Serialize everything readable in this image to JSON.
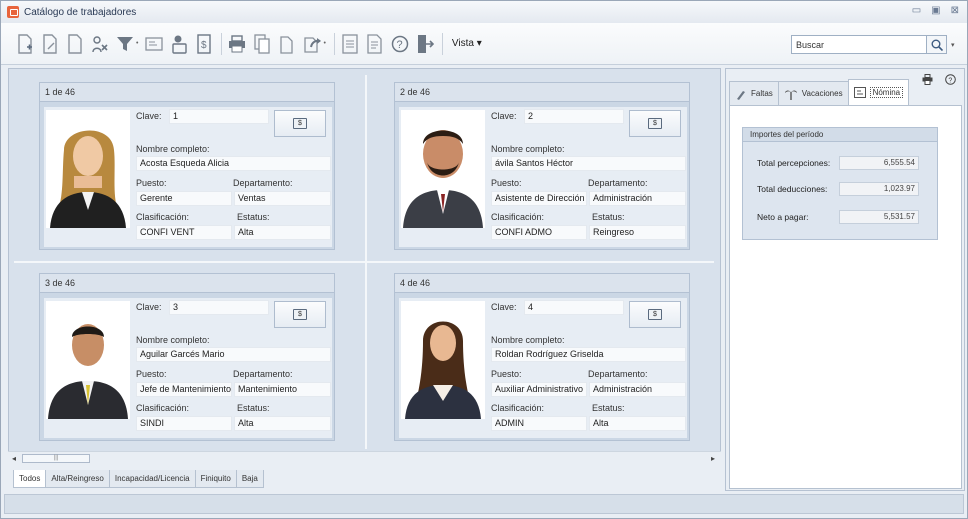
{
  "window": {
    "title": "Catálogo de trabajadores",
    "controls": [
      "▭",
      "▣",
      "⊠"
    ]
  },
  "toolbar": {
    "buttons": [
      "new-icon",
      "edit-icon",
      "blank-icon",
      "delete-icon",
      "filter-icon",
      "report-icon",
      "user-search-icon",
      "payroll-icon",
      "print-icon",
      "copy-icon",
      "document-icon",
      "refresh-icon",
      "export-icon",
      "list-icon",
      "help-icon",
      "exit-icon"
    ],
    "vista_label": "Vista ▾",
    "search_placeholder": "Buscar"
  },
  "cards": [
    {
      "header": "1 de 46",
      "clave_label": "Clave:",
      "clave": "1",
      "nombre_label": "Nombre completo:",
      "nombre": "Acosta Esqueda Alicia",
      "puesto_label": "Puesto:",
      "puesto": "Gerente",
      "depto_label": "Departamento:",
      "depto": "Ventas",
      "clasif_label": "Clasificación:",
      "clasif": "CONFI VENT",
      "estatus_label": "Estatus:",
      "estatus": "Alta"
    },
    {
      "header": "2 de 46",
      "clave_label": "Clave:",
      "clave": "2",
      "nombre_label": "Nombre completo:",
      "nombre": "ávila Santos Héctor",
      "puesto_label": "Puesto:",
      "puesto": "Asistente de Dirección",
      "depto_label": "Departamento:",
      "depto": "Administración",
      "clasif_label": "Clasificación:",
      "clasif": "CONFI ADMO",
      "estatus_label": "Estatus:",
      "estatus": "Reingreso"
    },
    {
      "header": "3 de 46",
      "clave_label": "Clave:",
      "clave": "3",
      "nombre_label": "Nombre completo:",
      "nombre": "Aguilar Garcés Mario",
      "puesto_label": "Puesto:",
      "puesto": "Jefe de Mantenimiento",
      "depto_label": "Departamento:",
      "depto": "Mantenimiento",
      "clasif_label": "Clasificación:",
      "clasif": "SINDI",
      "estatus_label": "Estatus:",
      "estatus": "Alta"
    },
    {
      "header": "4 de 46",
      "clave_label": "Clave:",
      "clave": "4",
      "nombre_label": "Nombre completo:",
      "nombre": "Roldan Rodríguez Griselda",
      "puesto_label": "Puesto:",
      "puesto": "Auxiliar Administrativo",
      "depto_label": "Departamento:",
      "depto": "Administración",
      "clasif_label": "Clasificación:",
      "clasif": "ADMIN",
      "estatus_label": "Estatus:",
      "estatus": "Alta"
    }
  ],
  "bottom_tabs": [
    "Todos",
    "Alta/Reingreso",
    "Incapacidad/Licencia",
    "Finiquito",
    "Baja"
  ],
  "right_panel": {
    "tabs": [
      "Faltas",
      "Vacaciones",
      "Nómina"
    ],
    "active_tab": "Nómina",
    "group_title": "Importes del período",
    "rows": [
      {
        "label": "Total percepciones:",
        "value": "6,555.54"
      },
      {
        "label": "Total deducciones:",
        "value": "1,023.97"
      },
      {
        "label": "Neto a pagar:",
        "value": "5,531.57"
      }
    ]
  }
}
